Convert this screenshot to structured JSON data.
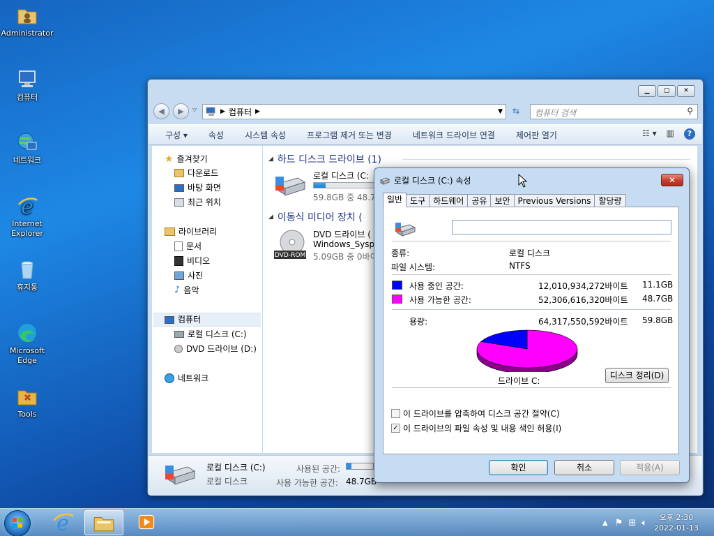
{
  "desktop": {
    "icons": [
      {
        "label": "Administrator"
      },
      {
        "label": "컴퓨터"
      },
      {
        "label": "네트워크"
      },
      {
        "label": "Internet Explorer"
      },
      {
        "label": "휴지통"
      },
      {
        "label": "Microsoft Edge"
      },
      {
        "label": "Tools"
      }
    ]
  },
  "explorer": {
    "address": "컴퓨터",
    "search_placeholder": "컴퓨터 검색",
    "toolbar": [
      "구성 ▾",
      "속성",
      "시스템 속성",
      "프로그램 제거 또는 변경",
      "네트워크 드라이브 연결",
      "제어판 열기"
    ],
    "nav": {
      "favorites": "즐겨찾기",
      "downloads": "다운로드",
      "desktop": "바탕 화면",
      "recent": "최근 위치",
      "libraries": "라이브러리",
      "documents": "문서",
      "videos": "비디오",
      "pictures": "사진",
      "music": "음악",
      "computer": "컴퓨터",
      "local_disk": "로컬 디스크 (C:)",
      "dvd_drive": "DVD 드라이브 (D:)",
      "network": "네트워크"
    },
    "groups": {
      "hdd": "하드 디스크 드라이브 (1)",
      "removable": "이동식 미디어 장치 ("
    },
    "drives": {
      "c_name": "로컬 디스크 (C:",
      "c_free": "59.8GB 중 48.7G",
      "c_used_fraction": 0.19,
      "d_name": "DVD 드라이브 (",
      "d_label": "Windows_Syspre",
      "d_free": "5.09GB 중 0바이",
      "d_badge": "DVD-ROM"
    },
    "details": {
      "name": "로컬 디스크 (C:)",
      "type": "로컬 디스크",
      "used_label": "사용된 공간:",
      "free_label": "사용 가능한 공간:",
      "free_value": "48.7GB"
    }
  },
  "properties": {
    "title": "로컬 디스크 (C:) 속성",
    "tabs": [
      "일반",
      "도구",
      "하드웨어",
      "공유",
      "보안",
      "Previous Versions",
      "할당량"
    ],
    "name_value": "",
    "type_label": "종류:",
    "type_value": "로컬 디스크",
    "fs_label": "파일 시스템:",
    "fs_value": "NTFS",
    "used_label": "사용 중인 공간:",
    "used_bytes": "12,010,934,272바이트",
    "used_gb": "11.1GB",
    "free_label": "사용 가능한 공간:",
    "free_bytes": "52,306,616,320바이트",
    "free_gb": "48.7GB",
    "capacity_label": "용량:",
    "capacity_bytes": "64,317,550,592바이트",
    "capacity_gb": "59.8GB",
    "used_fraction": 0.186,
    "used_color": "#0000ff",
    "free_color": "#ff00ff",
    "drive_label": "드라이브 C:",
    "cleanup_button": "디스크 정리(D)",
    "compress_label": "이 드라이브를 압축하여 디스크 공간 절약(C)",
    "compress_checked": false,
    "index_label": "이 드라이브의 파일 속성 및 내용 색인 허용(I)",
    "index_checked": true,
    "ok": "확인",
    "cancel": "취소",
    "apply": "적용(A)"
  },
  "taskbar": {
    "time": "오후 2:30",
    "date": "2022-01-13"
  }
}
